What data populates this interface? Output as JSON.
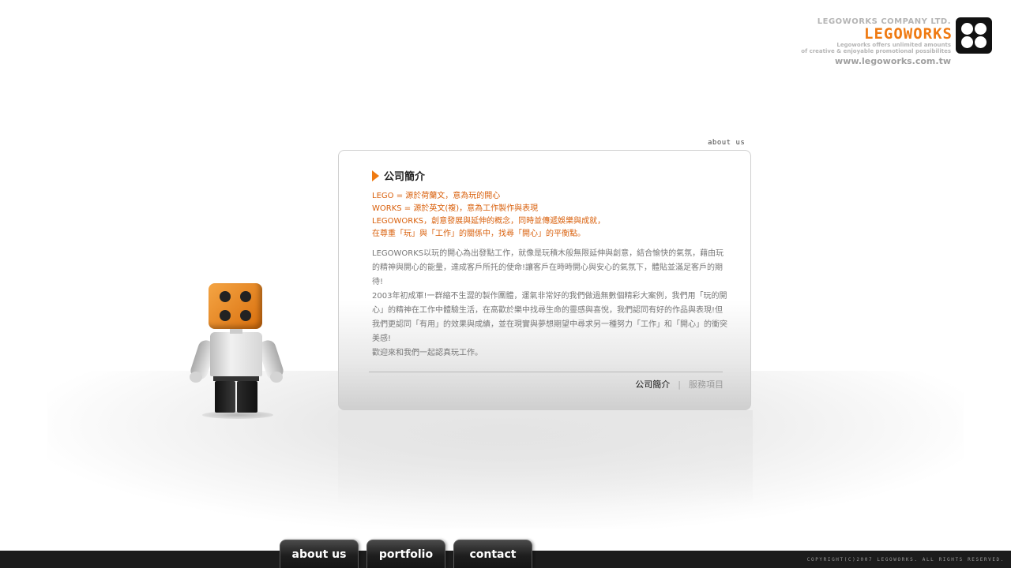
{
  "logo": {
    "company": "LEGOWORKS COMPANY LTD.",
    "wordmark": "LEGOWORKS",
    "tagline_1": "Legoworks offers unlimited amounts",
    "tagline_2": "of creative & enjoyable promotional possibilites",
    "url": "www.legoworks.com.tw"
  },
  "section_label": "about us",
  "panel": {
    "title": "公司簡介",
    "highlight": [
      "LEGO = 源於荷蘭文，意為玩的開心",
      "WORKS = 源於英文(複)，意為工作製作與表現",
      "LEGOWORKS，創意發展與延伸的概念，同時並傳遞娛樂與成就，",
      "在尊重「玩」與「工作」的關係中，找尋「開心」的平衡點。"
    ],
    "body": "LEGOWORKS以玩的開心為出發點工作，就像是玩積木般無限延伸與創意，結合愉快的氣氛，藉由玩的精神與開心的能量，達成客戶所托的使命!讓客戶在時時開心與安心的氣氛下，體貼並滿足客戶的期待!\n2003年初成軍!一群縮不生澀的製作團體，運氣非常好的我們做過無數個精彩大案例，我們用「玩的開心」的精神在工作中體驗生活，在高歡於樂中找尋生命的靈感與喜悅，我們認同有好的作品與表現!但我們更認同「有用」的效果與成績，並在現實與夢想期望中尋求另一種努力「工作」和「開心」的衝突美感!\n歡迎來和我們一起認真玩工作。",
    "subnav": {
      "active": "公司簡介",
      "separator": "|",
      "inactive": "服務項目"
    }
  },
  "nav": {
    "about": "about us",
    "portfolio": "portfolio",
    "contact": "contact"
  },
  "copyright": "COPYRIGHT(C)2007 LEGOWORKS. ALL RIGHTS RESERVED.",
  "colors": {
    "accent": "#ef7a12",
    "highlight_text": "#d9600c",
    "bottom_bar": "#1c1c1c"
  }
}
